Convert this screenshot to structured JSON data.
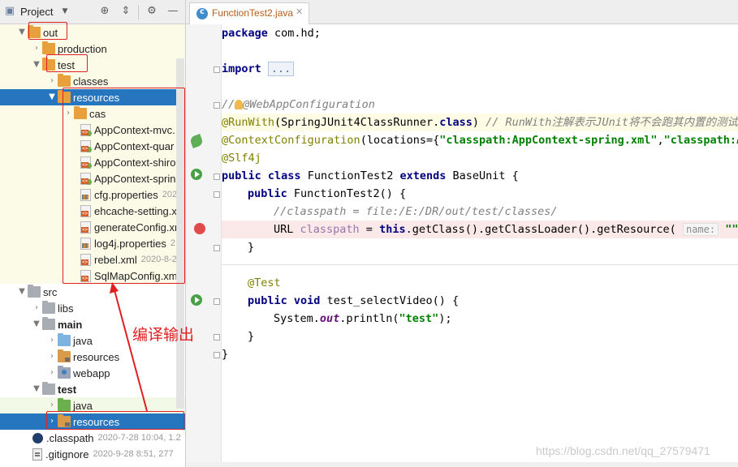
{
  "project_panel": {
    "title": "Project",
    "tree": [
      {
        "label": "out",
        "icon": "folder-icon",
        "style": "normal",
        "chev": "down",
        "meta": ""
      },
      {
        "label": "production",
        "icon": "folder-icon",
        "style": "normal",
        "chev": "right",
        "meta": ""
      },
      {
        "label": "test",
        "icon": "folder-icon",
        "style": "normal",
        "chev": "down",
        "meta": ""
      },
      {
        "label": "classes",
        "icon": "folder-icon",
        "style": "normal",
        "chev": "right",
        "meta": ""
      },
      {
        "label": "resources",
        "icon": "folder-icon",
        "style": "normal",
        "chev": "down",
        "meta": ""
      },
      {
        "label": "cas",
        "icon": "folder-icon",
        "style": "normal",
        "chev": "right",
        "meta": ""
      },
      {
        "label": "AppContext-mvc.",
        "icon": "xml-spring-icon",
        "style": "normal",
        "chev": "",
        "meta": ""
      },
      {
        "label": "AppContext-quar",
        "icon": "xml-spring-icon",
        "style": "normal",
        "chev": "",
        "meta": ""
      },
      {
        "label": "AppContext-shiro",
        "icon": "xml-spring-icon",
        "style": "normal",
        "chev": "",
        "meta": ""
      },
      {
        "label": "AppContext-sprin",
        "icon": "xml-spring-icon",
        "style": "normal",
        "chev": "",
        "meta": ""
      },
      {
        "label": "cfg.properties",
        "icon": "properties-icon",
        "style": "normal",
        "chev": "",
        "meta": "202"
      },
      {
        "label": "ehcache-setting.x",
        "icon": "xml-icon",
        "style": "normal",
        "chev": "",
        "meta": ""
      },
      {
        "label": "generateConfig.xr",
        "icon": "xml-icon",
        "style": "normal",
        "chev": "",
        "meta": ""
      },
      {
        "label": "log4j.properties",
        "icon": "properties-icon",
        "style": "normal",
        "chev": "",
        "meta": "2"
      },
      {
        "label": "rebel.xml",
        "icon": "xml-icon",
        "style": "normal",
        "chev": "",
        "meta": "2020-8-2"
      },
      {
        "label": "SqlMapConfig.xm",
        "icon": "xml-icon",
        "style": "normal",
        "chev": "",
        "meta": ""
      },
      {
        "label": "src",
        "icon": "folder-icon",
        "style": "normal",
        "chev": "down",
        "meta": ""
      },
      {
        "label": "libs",
        "icon": "folder-icon",
        "style": "normal",
        "chev": "right",
        "meta": ""
      },
      {
        "label": "main",
        "icon": "folder-icon",
        "style": "bold",
        "chev": "down",
        "meta": ""
      },
      {
        "label": "java",
        "icon": "folder-icon",
        "style": "normal",
        "chev": "right",
        "meta": ""
      },
      {
        "label": "resources",
        "icon": "folder-icon",
        "style": "normal",
        "chev": "right",
        "meta": ""
      },
      {
        "label": "webapp",
        "icon": "folder-icon",
        "style": "normal",
        "chev": "right",
        "meta": ""
      },
      {
        "label": "test",
        "icon": "folder-icon",
        "style": "bold",
        "chev": "down",
        "meta": ""
      },
      {
        "label": "java",
        "icon": "folder-icon",
        "style": "green",
        "chev": "right",
        "meta": ""
      },
      {
        "label": "resources",
        "icon": "folder-icon",
        "style": "normal",
        "chev": "right",
        "meta": ""
      },
      {
        "label": ".classpath",
        "icon": "eclipse-icon",
        "style": "normal",
        "chev": "",
        "meta": "2020-7-28 10:04, 1.2"
      },
      {
        "label": ".gitignore",
        "icon": "gitignore-icon",
        "style": "normal",
        "chev": "",
        "meta": "2020-9-28 8:51, 277"
      }
    ]
  },
  "editor": {
    "tab_label": "FunctionTest2.java",
    "code": {
      "l1_pkg": "package",
      "l1_name": " com.hd;",
      "l3_import": "import",
      "l3_fold": "...",
      "l5_cmt": "//",
      "l5_rest": "@WebAppConfiguration",
      "l6_ann": "@RunWith",
      "l6_open": "(SpringJUnit4ClassRunner.",
      "l6_class": "class",
      "l6_close": ")",
      "l6_cmt": " // RunWith注解表示JUnit将不会跑其内置的测试",
      "l7_ann": "@ContextConfiguration",
      "l7_open": "(locations={",
      "l7_s1": "\"classpath:AppContext-spring.xml\"",
      "l7_comma": ",",
      "l7_s2": "\"classpath:Ap",
      "l8_ann": "@Slf4j",
      "l9_public": "public",
      "l9_class": "class",
      "l9_name": " FunctionTest2 ",
      "l9_extends": "extends",
      "l9_base": " BaseUnit {",
      "l10_public": "public",
      "l10_rest": " FunctionTest2() {",
      "l11_cmt": "//classpath = file:/E:/DR/out/test/classes/",
      "l12_url": "URL ",
      "l12_var": "classpath",
      "l12_eq": " = ",
      "l12_this": "this",
      "l12_call": ".getClass().getClassLoader().getResource(",
      "l12_hint": "name:",
      "l12_str": " \"\"",
      "l12_end": ");",
      "l13_close": "}",
      "l15_ann": "@Test",
      "l16_public": "public",
      "l16_void": "void",
      "l16_name": " test_selectVideo() {",
      "l17_sys": "System.",
      "l17_out": "out",
      "l17_println": ".println(",
      "l17_str": "\"test\"",
      "l17_end": ");",
      "l18_close": "}",
      "l19_close": "}"
    }
  },
  "annotation": {
    "text": "编译输出"
  },
  "watermark": "https://blog.csdn.net/qq_27579471",
  "colors": {
    "selection": "#2675bf",
    "annotation_red": "#e02020",
    "keyword": "#000080",
    "string": "#008000",
    "annotation": "#808000"
  }
}
